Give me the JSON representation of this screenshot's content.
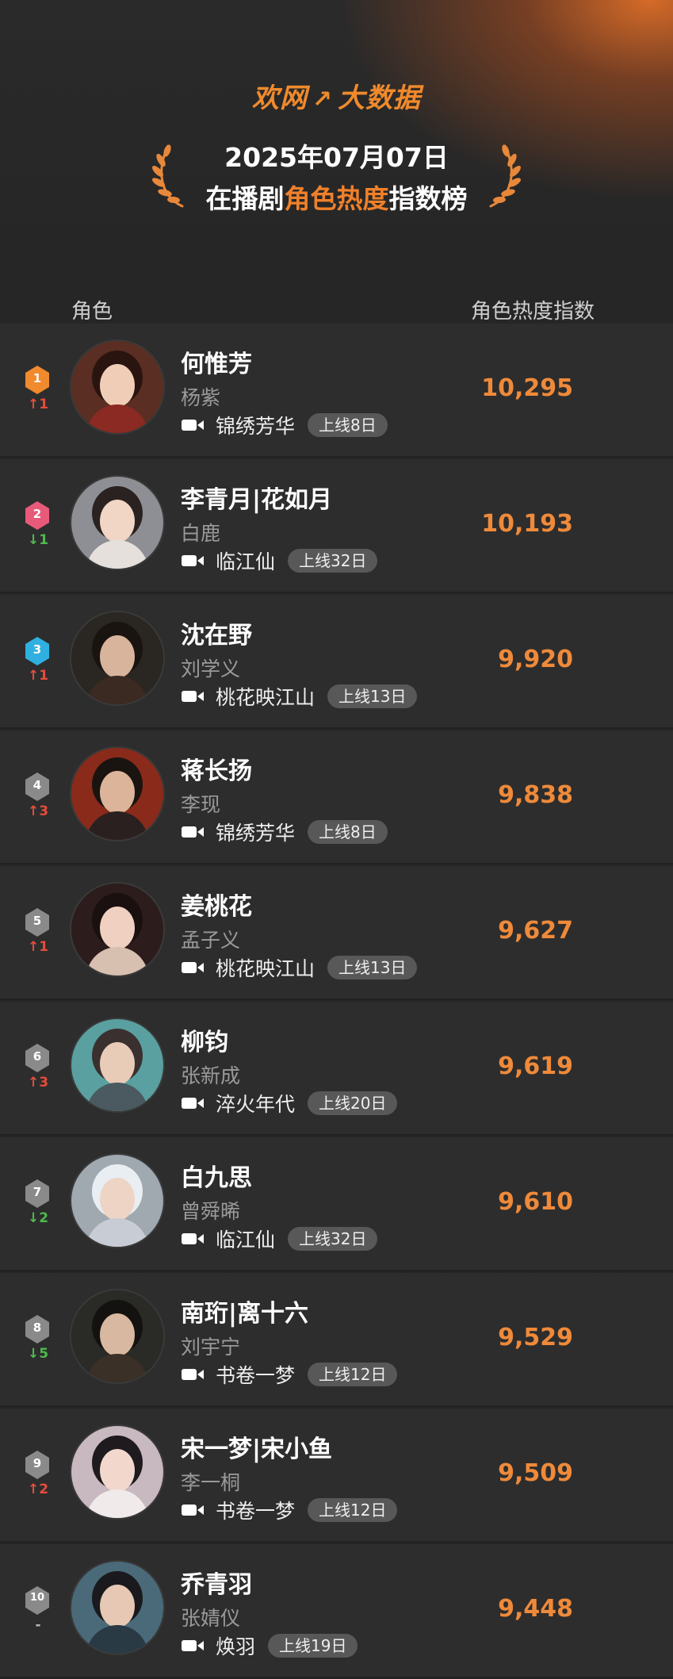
{
  "header": {
    "brand_left": "欢网",
    "brand_right": "大数据",
    "date": "2025年07月07日",
    "title_pre": "在播剧",
    "title_highlight": "角色热度",
    "title_post": "指数榜"
  },
  "columns": {
    "role": "角色",
    "index": "角色热度指数"
  },
  "colors": {
    "accent": "#ef8a3a",
    "up": "#e64c3c",
    "down": "#4dbb4d",
    "rank1": "#f08a2c",
    "rank2": "#e85a7a",
    "rank3": "#2fb0e0",
    "rank_other": "#8a8a8a"
  },
  "rows": [
    {
      "rank": "1",
      "trend": "↑1",
      "trend_dir": "up",
      "role": "何惟芳",
      "actor": "杨紫",
      "drama": "锦绣芳华",
      "days": "上线8日",
      "score": "10,295"
    },
    {
      "rank": "2",
      "trend": "↓1",
      "trend_dir": "down",
      "role": "李青月|花如月",
      "actor": "白鹿",
      "drama": "临江仙",
      "days": "上线32日",
      "score": "10,193"
    },
    {
      "rank": "3",
      "trend": "↑1",
      "trend_dir": "up",
      "role": "沈在野",
      "actor": "刘学义",
      "drama": "桃花映江山",
      "days": "上线13日",
      "score": "9,920"
    },
    {
      "rank": "4",
      "trend": "↑3",
      "trend_dir": "up",
      "role": "蒋长扬",
      "actor": "李现",
      "drama": "锦绣芳华",
      "days": "上线8日",
      "score": "9,838"
    },
    {
      "rank": "5",
      "trend": "↑1",
      "trend_dir": "up",
      "role": "姜桃花",
      "actor": "孟子义",
      "drama": "桃花映江山",
      "days": "上线13日",
      "score": "9,627"
    },
    {
      "rank": "6",
      "trend": "↑3",
      "trend_dir": "up",
      "role": "柳钧",
      "actor": "张新成",
      "drama": "淬火年代",
      "days": "上线20日",
      "score": "9,619"
    },
    {
      "rank": "7",
      "trend": "↓2",
      "trend_dir": "down",
      "role": "白九思",
      "actor": "曾舜晞",
      "drama": "临江仙",
      "days": "上线32日",
      "score": "9,610"
    },
    {
      "rank": "8",
      "trend": "↓5",
      "trend_dir": "down",
      "role": "南珩|离十六",
      "actor": "刘宇宁",
      "drama": "书卷一梦",
      "days": "上线12日",
      "score": "9,529"
    },
    {
      "rank": "9",
      "trend": "↑2",
      "trend_dir": "up",
      "role": "宋一梦|宋小鱼",
      "actor": "李一桐",
      "drama": "书卷一梦",
      "days": "上线12日",
      "score": "9,509"
    },
    {
      "rank": "10",
      "trend": "-",
      "trend_dir": "same",
      "role": "乔青羽",
      "actor": "张婧仪",
      "drama": "焕羽",
      "days": "上线19日",
      "score": "9,448"
    }
  ]
}
